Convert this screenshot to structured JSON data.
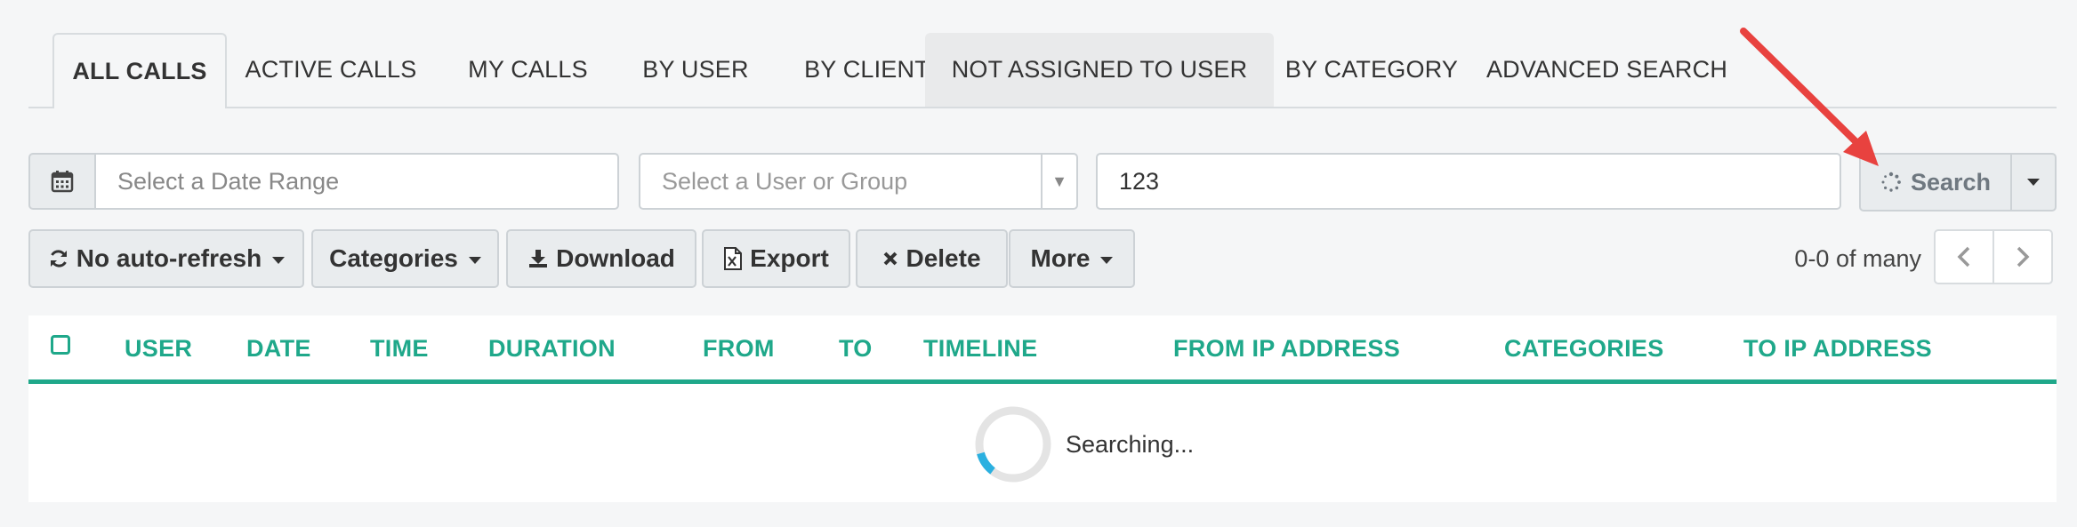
{
  "tabs": [
    {
      "label": "ALL CALLS",
      "active": true
    },
    {
      "label": "ACTIVE CALLS"
    },
    {
      "label": "MY CALLS"
    },
    {
      "label": "BY USER"
    },
    {
      "label": "BY CLIENT"
    },
    {
      "label": "NOT ASSIGNED TO USER",
      "hover": true
    },
    {
      "label": "BY CATEGORY"
    },
    {
      "label": "ADVANCED SEARCH"
    }
  ],
  "filters": {
    "date_icon": "calendar-icon",
    "date_placeholder": "Select a Date Range",
    "user_placeholder": "Select a User or Group",
    "search_value": "123",
    "search_button": "Search",
    "search_icon": "spinner-icon"
  },
  "actions": {
    "refresh": "No auto-refresh",
    "categories": "Categories",
    "download": "Download",
    "export": "Export",
    "delete": "Delete",
    "more": "More"
  },
  "pager": {
    "text": "0-0 of many"
  },
  "table": {
    "columns": [
      "USER",
      "DATE",
      "TIME",
      "DURATION",
      "FROM",
      "TO",
      "TIMELINE",
      "FROM IP ADDRESS",
      "CATEGORIES",
      "TO IP ADDRESS"
    ],
    "loading_text": "Searching..."
  },
  "colors": {
    "accent": "#1fa88a",
    "arrow": "#e8423f",
    "spinner": "#2bb0e0"
  }
}
